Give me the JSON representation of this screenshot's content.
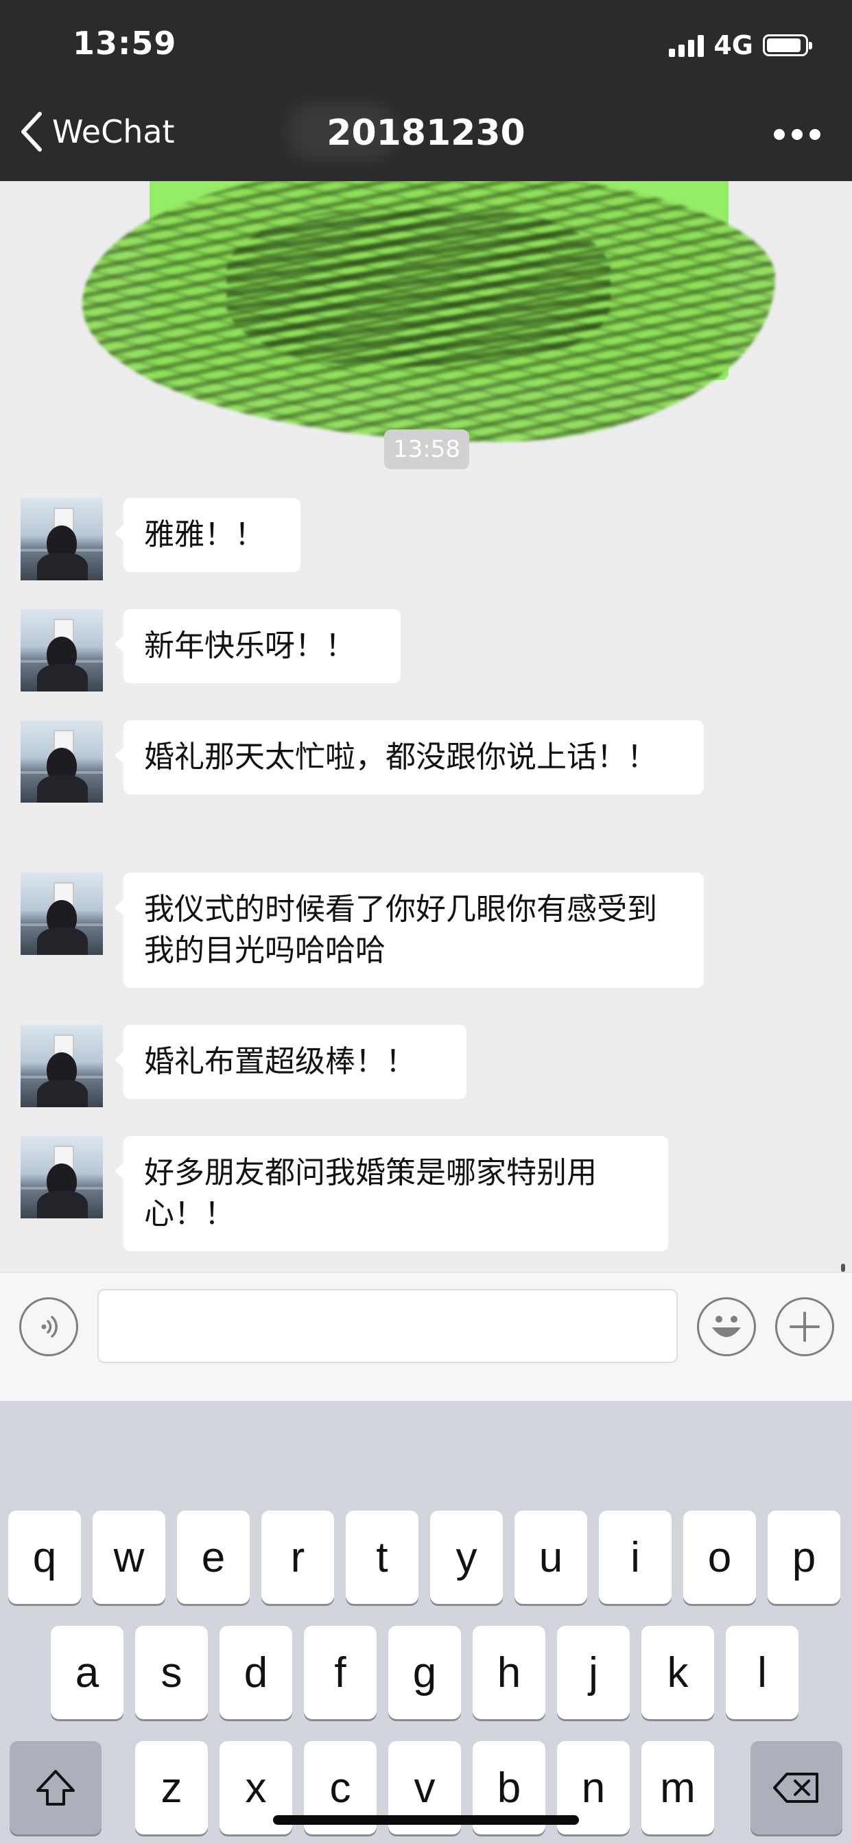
{
  "status_bar": {
    "time": "13:59",
    "network": "4G",
    "signal_bars": 4,
    "battery_level_percent": 90
  },
  "nav": {
    "back_label": "WeChat",
    "title": "20181230"
  },
  "chat": {
    "redacted_bubble_color": "#95ec69",
    "timestamp": "13:58",
    "messages": [
      {
        "text": "雅雅！！"
      },
      {
        "text": "新年快乐呀！！"
      },
      {
        "text": "婚礼那天太忙啦，都没跟你说上话！！"
      },
      {
        "text": "我仪式的时候看了你好几眼你有感受到我的目光吗哈哈哈"
      },
      {
        "text": "婚礼布置超级棒！！"
      },
      {
        "text": "好多朋友都问我婚策是哪家特别用心！！"
      }
    ]
  },
  "input_bar": {
    "voice_icon": "voice-icon",
    "emoji_icon": "emoji-icon",
    "plus_icon": "plus-icon"
  },
  "keyboard": {
    "row1": [
      "q",
      "w",
      "e",
      "r",
      "t",
      "y",
      "u",
      "i",
      "o",
      "p"
    ],
    "row2": [
      "a",
      "s",
      "d",
      "f",
      "g",
      "h",
      "j",
      "k",
      "l"
    ],
    "row3": [
      "z",
      "x",
      "c",
      "v",
      "b",
      "n",
      "m"
    ],
    "shift_icon": "shift-icon",
    "delete_icon": "backspace-icon"
  }
}
